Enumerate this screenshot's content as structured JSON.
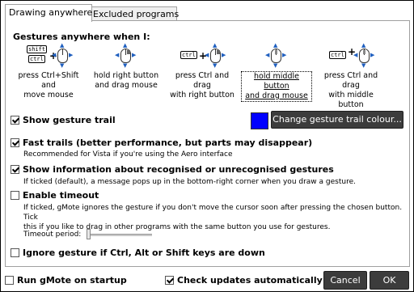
{
  "tabs": [
    {
      "label": "Drawing anywhere",
      "active": true
    },
    {
      "label": "Excluded programs",
      "active": false
    }
  ],
  "gestures": {
    "heading": "Gestures anywhere when I:",
    "options": [
      {
        "line1": "press Ctrl+Shift and",
        "line2": "move mouse",
        "keys": [
          "shift",
          "ctrl"
        ],
        "mouse_button": "none",
        "selected": false
      },
      {
        "line1": "hold right button",
        "line2": "and drag mouse",
        "keys": [],
        "mouse_button": "right",
        "selected": false
      },
      {
        "line1": "press Ctrl and drag",
        "line2": "with right button",
        "keys": [
          "ctrl"
        ],
        "mouse_button": "right",
        "selected": false
      },
      {
        "line1": "hold middle button",
        "line2": "and drag mouse",
        "keys": [],
        "mouse_button": "middle",
        "selected": true
      },
      {
        "line1": "press Ctrl and drag",
        "line2": "with middle button",
        "keys": [
          "ctrl"
        ],
        "mouse_button": "middle",
        "selected": false
      }
    ]
  },
  "trail": {
    "label": "Show gesture trail",
    "checked": true,
    "colour": "#0000ff",
    "change_button": "Change gesture trail colour..."
  },
  "fast_trails": {
    "label": "Fast trails (better performance, but parts may disappear)",
    "checked": true,
    "desc": "Recommended for Vista if you're using the Aero interface"
  },
  "show_info": {
    "label": "Show information about recognised or unrecognised gestures",
    "checked": true,
    "desc": "If ticked (default), a message pops up in the bottom-right corner when you draw a gesture."
  },
  "timeout": {
    "label": "Enable timeout",
    "checked": false,
    "desc1": "If ticked, gMote ignores the gesture if you don't move the cursor soon after pressing the chosen button. Tick",
    "desc2": "this if you like to drag in other programs with the same button you use for gestures.",
    "period_label": "Timeout period:",
    "period_value": 0
  },
  "ignore_keys": {
    "label": "Ignore gesture if Ctrl, Alt or Shift keys are down",
    "checked": false
  },
  "footer": {
    "startup_label": "Run gMote on startup",
    "startup_checked": false,
    "updates_label": "Check updates automatically",
    "updates_checked": true,
    "cancel": "Cancel",
    "ok": "OK"
  }
}
